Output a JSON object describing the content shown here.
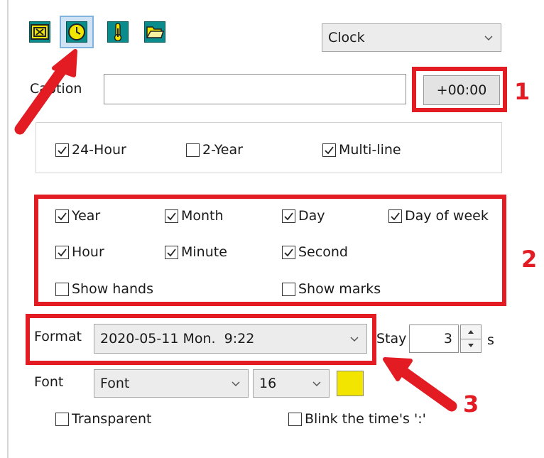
{
  "mode_select": {
    "value": "Clock"
  },
  "caption": {
    "label": "Caption",
    "value": "",
    "offset_button": "+00:00"
  },
  "display_options": [
    {
      "label": "24-Hour",
      "checked": true
    },
    {
      "label": "2-Year",
      "checked": false
    },
    {
      "label": "Multi-line",
      "checked": true
    }
  ],
  "fields": [
    {
      "label": "Year",
      "checked": true
    },
    {
      "label": "Month",
      "checked": true
    },
    {
      "label": "Day",
      "checked": true
    },
    {
      "label": "Day of week",
      "checked": true
    },
    {
      "label": "Hour",
      "checked": true
    },
    {
      "label": "Minute",
      "checked": true
    },
    {
      "label": "Second",
      "checked": true
    },
    {
      "label": "Show hands",
      "checked": false
    },
    {
      "label": "Show marks",
      "checked": false
    }
  ],
  "format": {
    "label": "Format",
    "value": "2020-05-11 Mon.  9:22"
  },
  "stay": {
    "label": "Stay",
    "value": "3",
    "unit": "s"
  },
  "font": {
    "label": "Font",
    "family_value": "Font",
    "size_value": "16",
    "color": "#f2e600"
  },
  "bottom_options": [
    {
      "label": "Transparent",
      "checked": false
    },
    {
      "label": "Blink the time's ':'",
      "checked": false
    }
  ],
  "annotations": {
    "n1": "1",
    "n2": "2",
    "n3": "3",
    "accent": "#e31b23"
  },
  "icons": [
    "text-icon",
    "clock-icon",
    "thermometer-icon",
    "folder-icon"
  ]
}
